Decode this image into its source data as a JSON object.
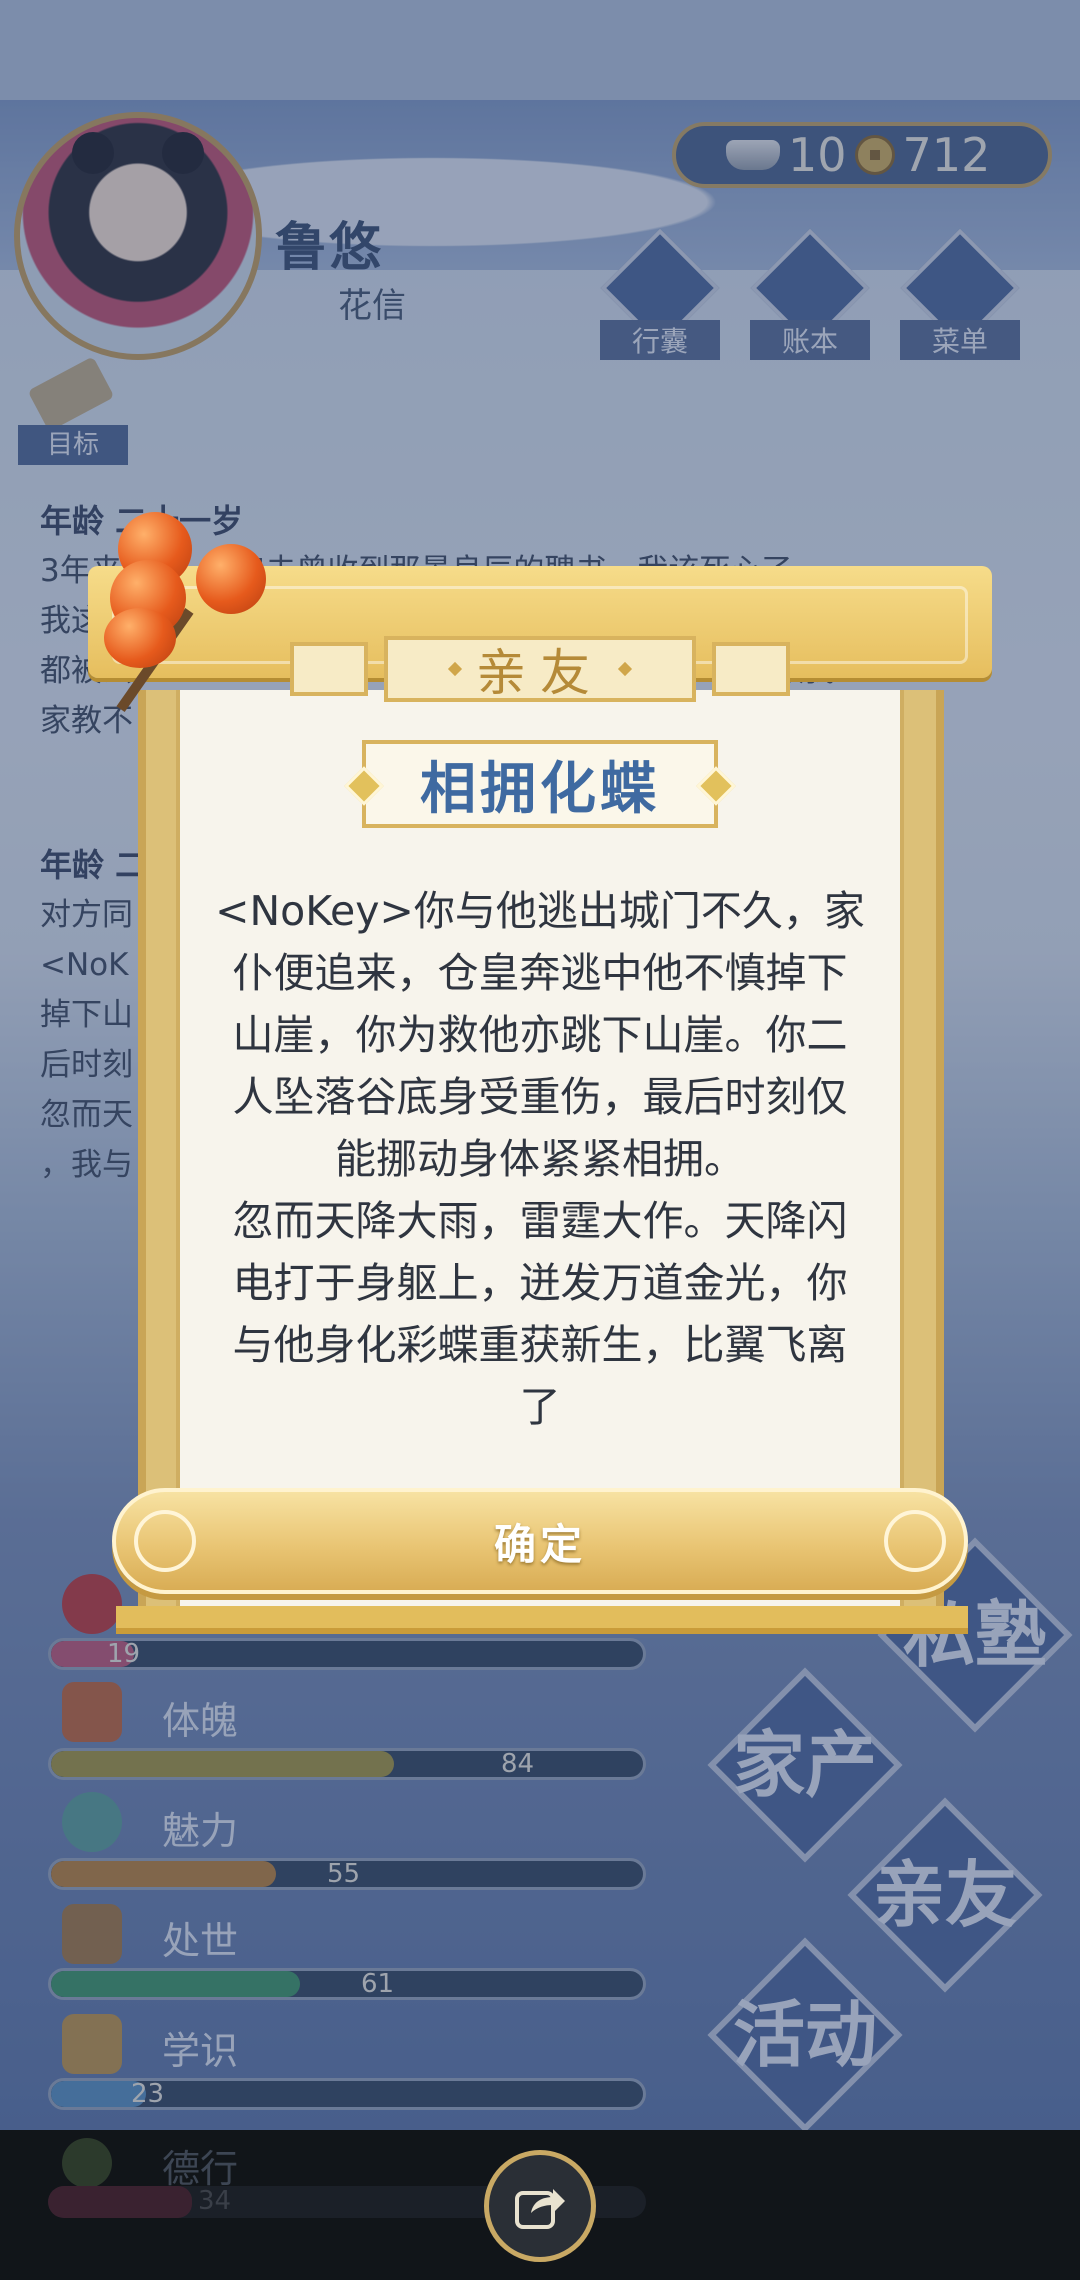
{
  "header": {
    "player_name": "鲁悠",
    "player_role": "花信",
    "goal_label": "目标",
    "currency": {
      "silver": "10",
      "coins": "712"
    },
    "buttons": [
      {
        "label": "行囊",
        "icon": "bag-icon"
      },
      {
        "label": "账本",
        "icon": "ledger-icon"
      },
      {
        "label": "菜单",
        "icon": "menu-icon"
      }
    ]
  },
  "bio": {
    "entry1_age": "年龄 二十一岁",
    "entry1_text": "3年来 …… 爹娘未曾收到那景良辰的聘书，我该死心了\n我这 …………………………………………………… 脸面\n都被丢 …………………………………………………… 赖我\n家教不",
    "entry2_age": "年龄 二",
    "entry2_text": "对方同\n<NoK …………………………………………………… 他不慎\n掉下山 …………………………………………………… ，最\n后时刻\n忽而天 …………………………………………………… 金光\n，我与"
  },
  "stats": [
    {
      "label": "",
      "value": "19",
      "icon": "flower-icon",
      "color": "#c75a78"
    },
    {
      "label": "体魄",
      "value": "84",
      "icon": "hydrant-icon",
      "color": "#a99a3e"
    },
    {
      "label": "魅力",
      "value": "55",
      "icon": "mirror-icon",
      "color": "#c0853a"
    },
    {
      "label": "处世",
      "value": "61",
      "icon": "hands-icon",
      "color": "#3f9a66"
    },
    {
      "label": "学识",
      "value": "23",
      "icon": "books-icon",
      "color": "#5a93c2"
    },
    {
      "label": "德行",
      "value": "34",
      "icon": "virtue-icon",
      "color": "#b05a7a"
    }
  ],
  "side_menu": [
    "私塾",
    "家产",
    "亲友",
    "活动"
  ],
  "dialog": {
    "title": "亲友",
    "subtitle": "相拥化蝶",
    "story": "<NoKey>你与他逃出城门不久，家\n仆便追来，仓皇奔逃中他不慎掉下\n山崖，你为救他亦跳下山崖。你二\n人坠落谷底身受重伤，最后时刻仅\n能挪动身体紧紧相拥。\n忽而天降大雨，雷霆大作。天降闪\n电打于身躯上，迸发万道金光，你\n与他身化彩蝶重获新生，比翼飞离\n了",
    "confirm_label": "确定"
  }
}
